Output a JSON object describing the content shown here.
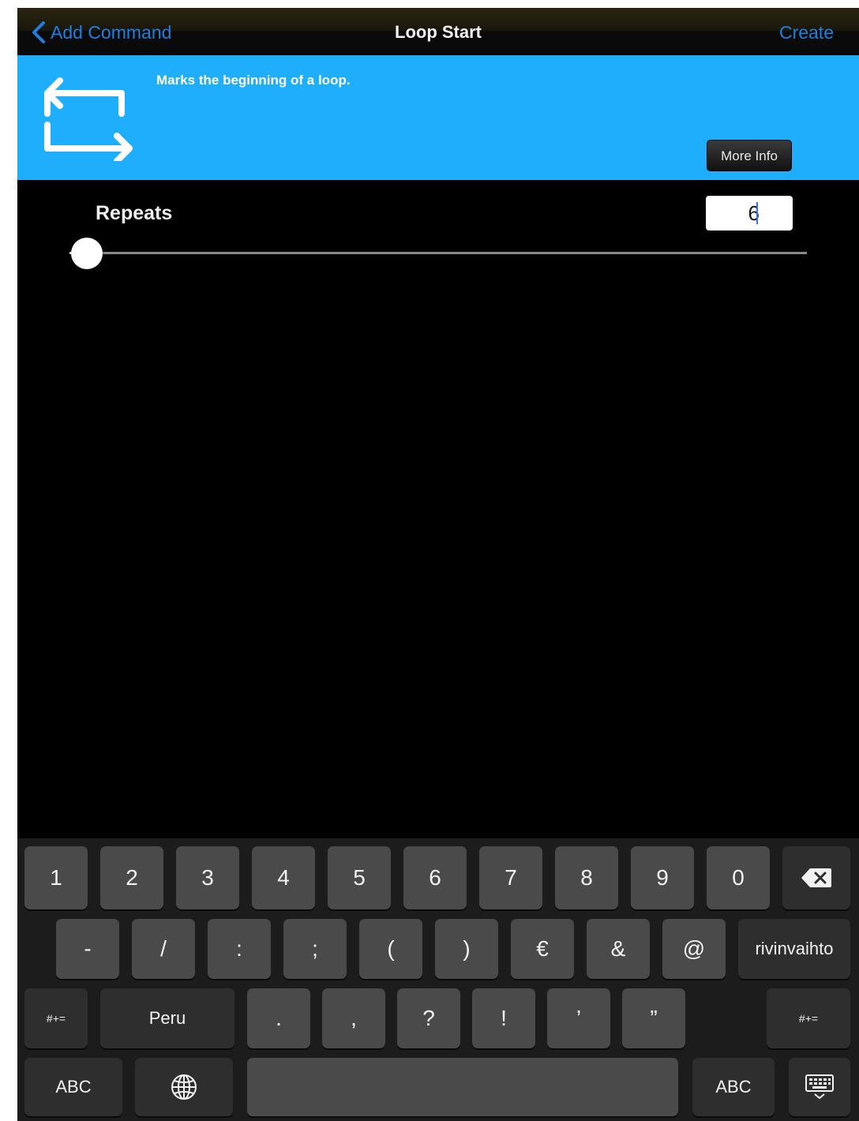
{
  "nav": {
    "back_label": "Add Command",
    "title": "Loop Start",
    "action_label": "Create"
  },
  "banner": {
    "icon": "loop-repeat-icon",
    "description": "Marks the beginning of a loop.",
    "more_info_label": "More Info"
  },
  "repeats": {
    "label": "Repeats",
    "value": "6",
    "slider_level": 0.0
  },
  "keyboard": {
    "row1": [
      "1",
      "2",
      "3",
      "4",
      "5",
      "6",
      "7",
      "8",
      "9",
      "0"
    ],
    "row2": [
      "-",
      "/",
      ":",
      ";",
      "(",
      ")",
      "€",
      "&",
      "@"
    ],
    "return_label": "rivinvaihto",
    "symbols_label": "#+=",
    "undo_label": "Peru",
    "row3": [
      ".",
      ",",
      "?",
      "!",
      "’",
      "”"
    ],
    "abc_label": "ABC",
    "globe_icon": "globe-icon",
    "delete_icon": "backspace-icon",
    "dismiss_icon": "keyboard-dismiss-icon"
  },
  "colors": {
    "accent": "#1f7fe0",
    "banner": "#1eaefc"
  }
}
